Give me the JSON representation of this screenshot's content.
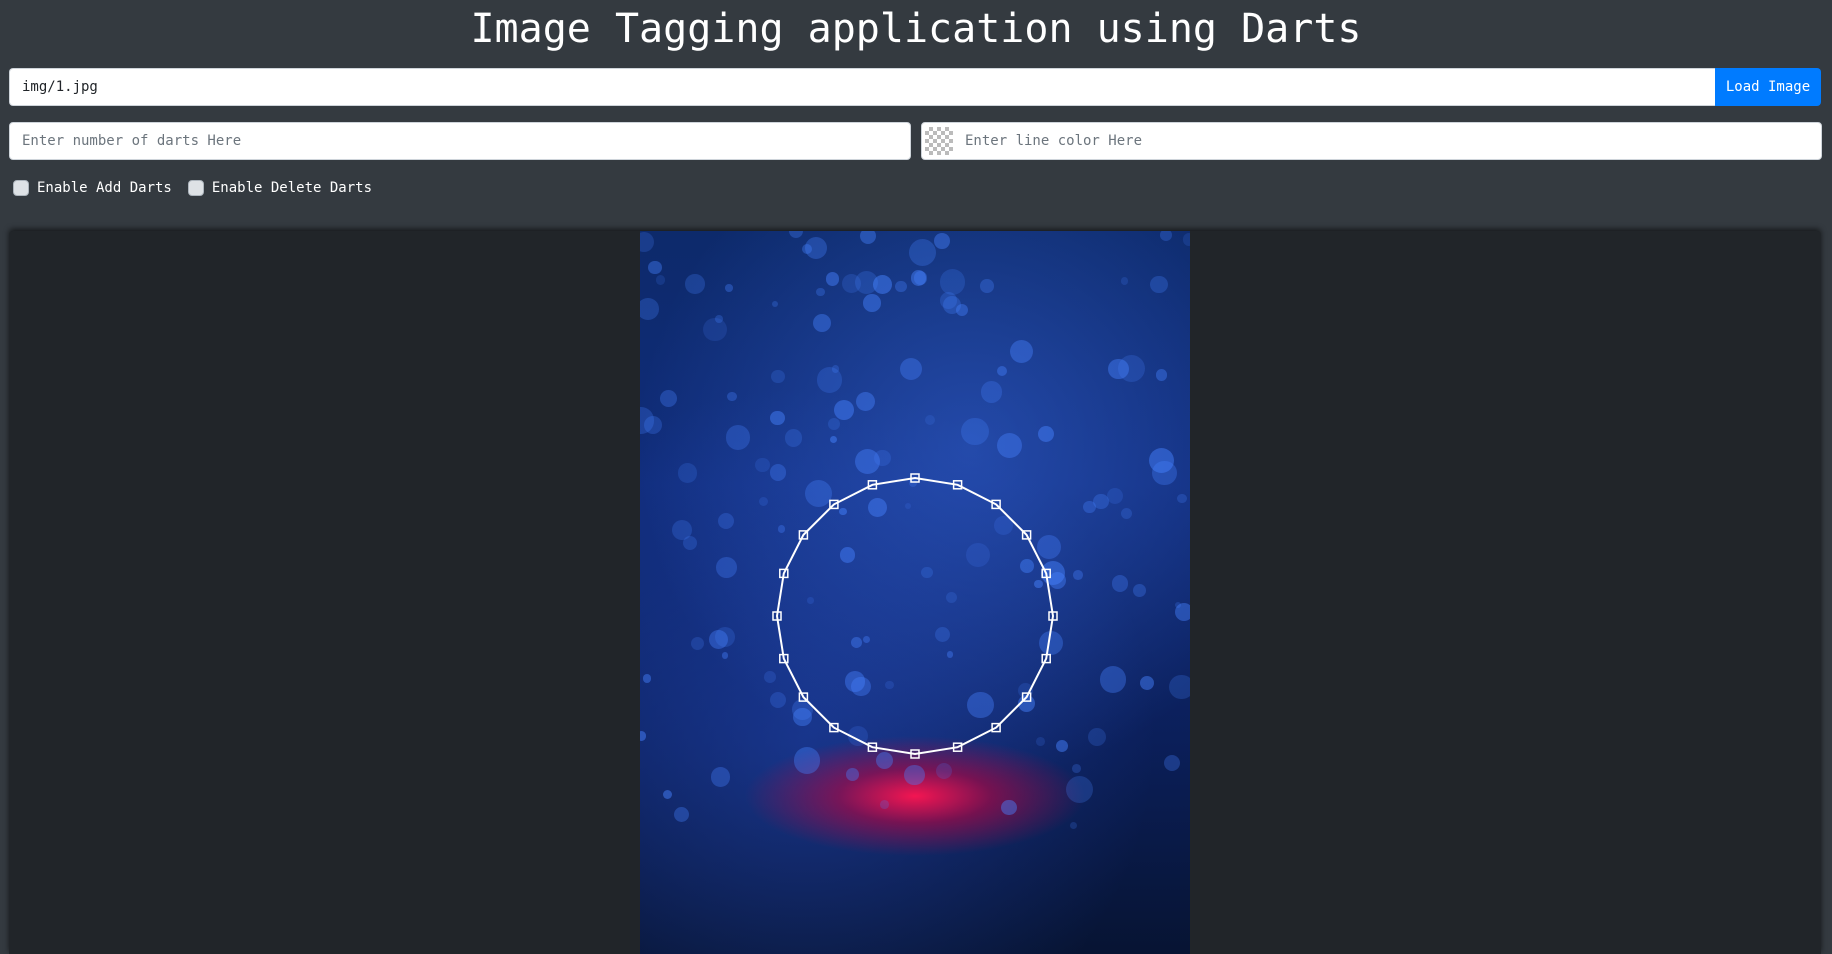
{
  "app": {
    "title": "Image Tagging application using Darts"
  },
  "image_loader": {
    "path_value": "img/1.jpg",
    "load_button_label": "Load Image"
  },
  "darts_input": {
    "value": "",
    "placeholder": "Enter number of darts Here"
  },
  "line_color_input": {
    "value": "",
    "placeholder": "Enter line color Here",
    "swatch_icon": "transparent-swatch-icon"
  },
  "options": {
    "add_darts_label": "Enable Add Darts",
    "add_darts_checked": false,
    "delete_darts_label": "Enable Delete Darts",
    "delete_darts_checked": false
  },
  "canvas": {
    "image_subject": "red water droplet splash on blue bokeh background",
    "dart_line_color": "#ffffff",
    "dart_count": 20
  },
  "colors": {
    "page_background": "#343a40",
    "stage_background": "#212529",
    "accent": "#007bff"
  }
}
